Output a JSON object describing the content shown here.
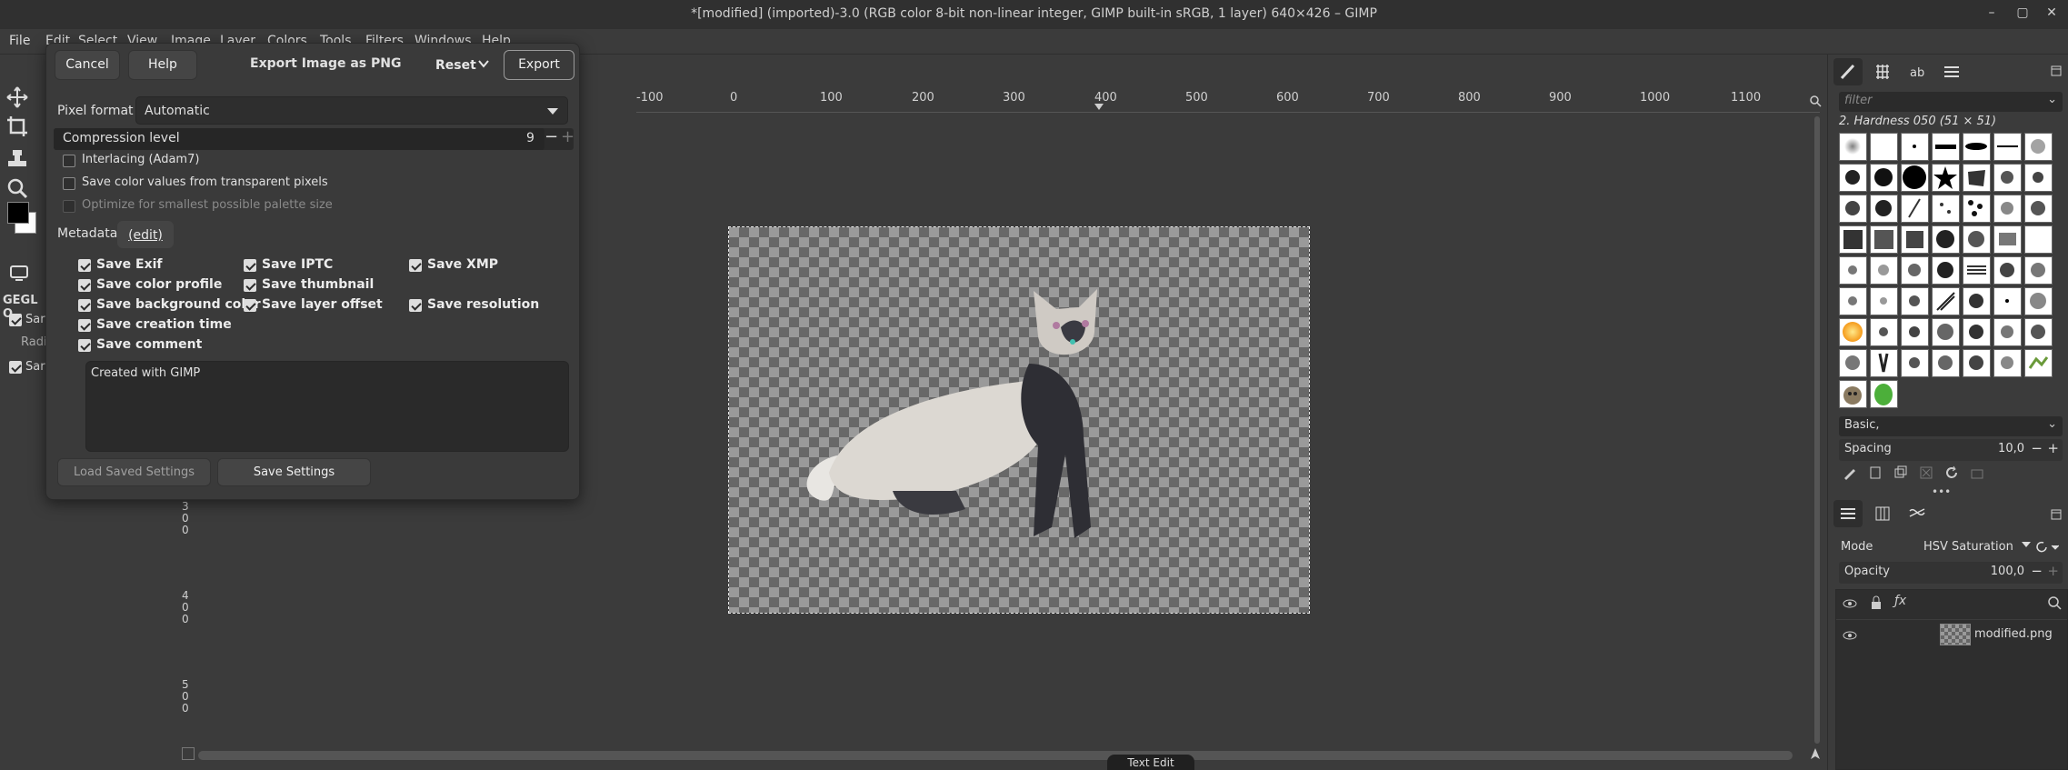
{
  "window": {
    "title": "*[modified] (imported)-3.0 (RGB color 8-bit non-linear integer, GIMP built-in sRGB, 1 layer) 640×426 – GIMP",
    "minimize": "–",
    "maximize": "▢",
    "close": "✕"
  },
  "menubar": [
    "File",
    "Edit",
    "Select",
    "View",
    "Image",
    "Layer",
    "Colors",
    "Tools",
    "Filters",
    "Windows",
    "Help"
  ],
  "ruler": {
    "ticks": [
      "-100",
      "0",
      "100",
      "200",
      "300",
      "400",
      "500",
      "600",
      "700",
      "800",
      "900",
      "1000",
      "1100"
    ],
    "vertical_ticks": [
      "3",
      "0",
      "0",
      "4",
      "0",
      "0",
      "5",
      "0",
      "0"
    ]
  },
  "toolbox": {
    "gegl_title": "GEGL O",
    "opt1": "Sar",
    "opt2": "Radi",
    "opt3": "Sar"
  },
  "dialog": {
    "title": "Export Image as PNG",
    "cancel": "Cancel",
    "help": "Help",
    "reset": "Reset",
    "export": "Export",
    "pixel_format_label": "Pixel format",
    "pixel_format_value": "Automatic",
    "compression_label": "Compression level",
    "compression_value": "9",
    "interlacing": "Interlacing (Adam7)",
    "save_color_values": "Save color values from transparent pixels",
    "optimize_palette": "Optimize for smallest possible palette size",
    "metadata_label": "Metadata",
    "metadata_edit": "(edit)",
    "save_exif": "Save Exif",
    "save_iptc": "Save IPTC",
    "save_xmp": "Save XMP",
    "save_color_profile": "Save color profile",
    "save_thumbnail": "Save thumbnail",
    "save_background_color": "Save background color",
    "save_layer_offset": "Save layer offset",
    "save_resolution": "Save resolution",
    "save_creation_time": "Save creation time",
    "save_comment": "Save comment",
    "comment_text": "Created with GIMP",
    "load_saved_settings": "Load Saved Settings",
    "save_settings": "Save Settings"
  },
  "dock": {
    "filter_placeholder": "filter",
    "brush_name": "2. Hardness 050 (51 × 51)",
    "preset": "Basic,",
    "spacing_label": "Spacing",
    "spacing_value": "10,0",
    "mode_label": "Mode",
    "mode_value": "HSV Saturation",
    "opacity_label": "Opacity",
    "opacity_value": "100,0",
    "layer_name": "modified.png"
  },
  "status": {
    "tooltip": "Text Edit"
  }
}
